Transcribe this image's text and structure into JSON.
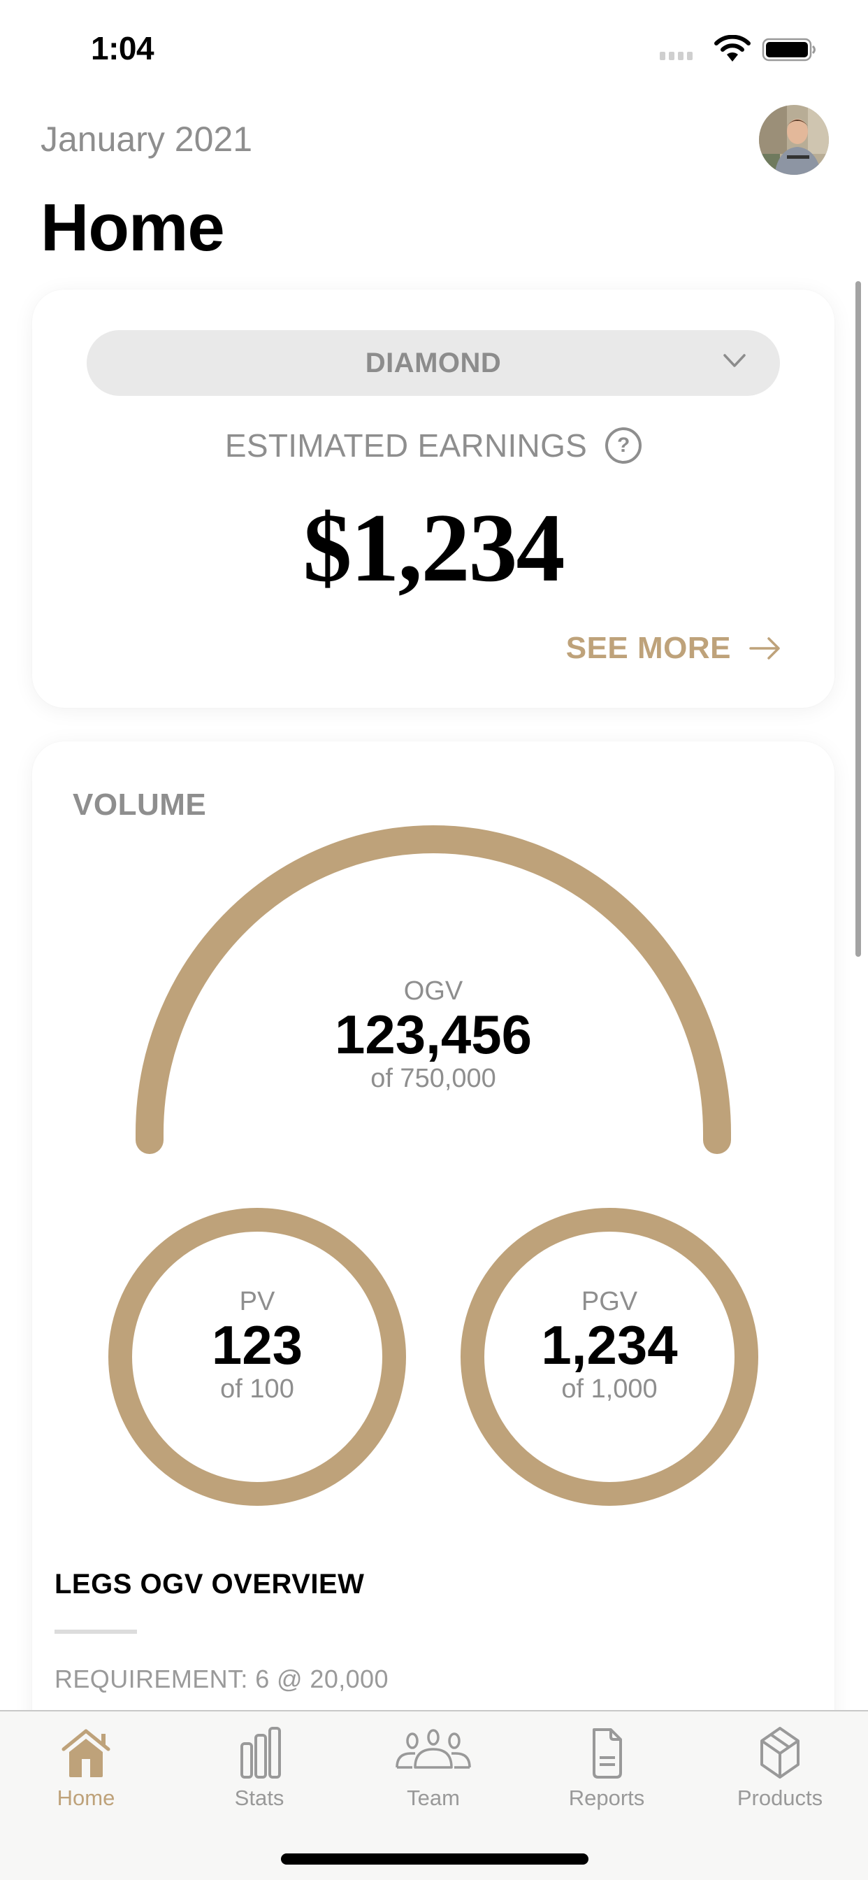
{
  "status_bar": {
    "time": "1:04",
    "icons": [
      "cellular-signal-icon",
      "wifi-icon",
      "battery-icon"
    ]
  },
  "header": {
    "month": "January 2021",
    "title": "Home",
    "avatar": "user-avatar"
  },
  "earnings_card": {
    "rank_selector": {
      "value": "DIAMOND",
      "icon": "chevron-down-icon"
    },
    "label": "ESTIMATED EARNINGS",
    "help_icon": "?",
    "value": "$1,234",
    "see_more_label": "SEE MORE",
    "see_more_icon": "arrow-right-icon"
  },
  "volume_card": {
    "title": "VOLUME",
    "ogv": {
      "label": "OGV",
      "value": "123,456",
      "target": "of 750,000",
      "progress": 1.0
    },
    "pv": {
      "label": "PV",
      "value": "123",
      "target": "of 100",
      "progress": 1.0
    },
    "pgv": {
      "label": "PGV",
      "value": "1,234",
      "target": "of 1,000",
      "progress": 1.0
    },
    "legs": {
      "title": "LEGS OGV OVERVIEW",
      "requirement": "REQUIREMENT: 6 @ 20,000"
    }
  },
  "tab_bar": {
    "items": [
      {
        "label": "Home",
        "icon": "home-icon",
        "active": true
      },
      {
        "label": "Stats",
        "icon": "bar-chart-icon",
        "active": false
      },
      {
        "label": "Team",
        "icon": "team-icon",
        "active": false
      },
      {
        "label": "Reports",
        "icon": "document-icon",
        "active": false
      },
      {
        "label": "Products",
        "icon": "box-icon",
        "active": false
      }
    ]
  },
  "colors": {
    "accent": "#bea27a",
    "muted_text": "#8e8e8e",
    "pill_bg": "#e9e9e9",
    "tab_bar_bg": "#f7f7f6"
  }
}
